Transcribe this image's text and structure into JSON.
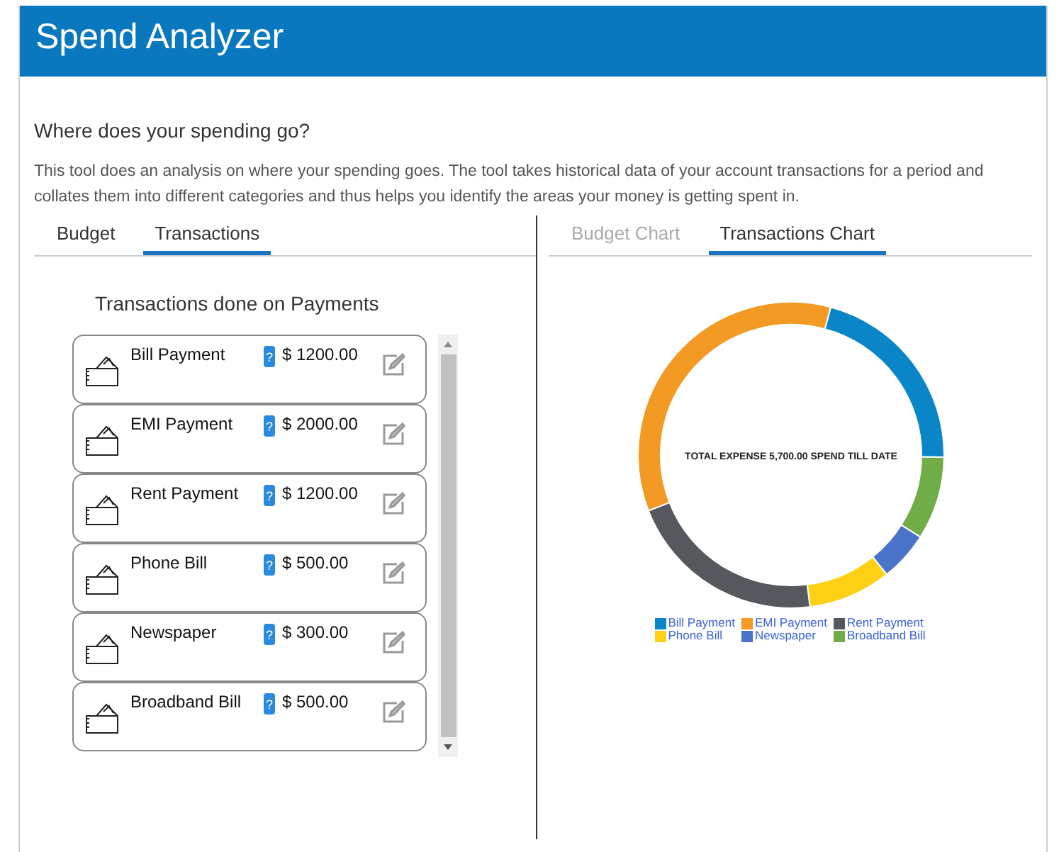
{
  "header": {
    "title": "Spend Analyzer"
  },
  "heading": "Where does your spending go?",
  "description": "This tool does an analysis on where your spending goes. The tool takes historical data of your account transactions for a period and collates them into different categories and thus helps you identify the areas your money is getting spent in.",
  "left_tabs": [
    {
      "label": "Budget",
      "selected": false
    },
    {
      "label": "Transactions",
      "selected": true
    }
  ],
  "list_title": "Transactions done on Payments",
  "transactions": [
    {
      "name": "Bill Payment",
      "help": "?",
      "amount": "$ 1200.00"
    },
    {
      "name": "EMI Payment",
      "help": "?",
      "amount": "$ 2000.00"
    },
    {
      "name": "Rent Payment",
      "help": "?",
      "amount": "$ 1200.00"
    },
    {
      "name": "Phone Bill",
      "help": "?",
      "amount": "$ 500.00"
    },
    {
      "name": "Newspaper",
      "help": "?",
      "amount": "$ 300.00"
    },
    {
      "name": "Broadband Bill",
      "help": "?",
      "amount": "$ 500.00"
    }
  ],
  "right_tabs": [
    {
      "label": "Budget Chart",
      "selected": false,
      "disabled": true
    },
    {
      "label": "Transactions Chart",
      "selected": true,
      "disabled": false
    }
  ],
  "chart": {
    "center_text": "TOTAL EXPENSE 5,700.00 SPEND TILL DATE",
    "chart_data": {
      "type": "donut",
      "legend": "bottom",
      "categories": [
        "Bill Payment",
        "EMI Payment",
        "Rent Payment",
        "Phone Bill",
        "Newspaper",
        "Broadband Bill"
      ],
      "values": [
        21.05,
        35.09,
        21.05,
        8.77,
        5.26,
        8.78
      ],
      "colors": [
        "#0a86c8",
        "#f29a24",
        "#55595e",
        "#fcd116",
        "#4a73c9",
        "#70ad47"
      ]
    }
  }
}
